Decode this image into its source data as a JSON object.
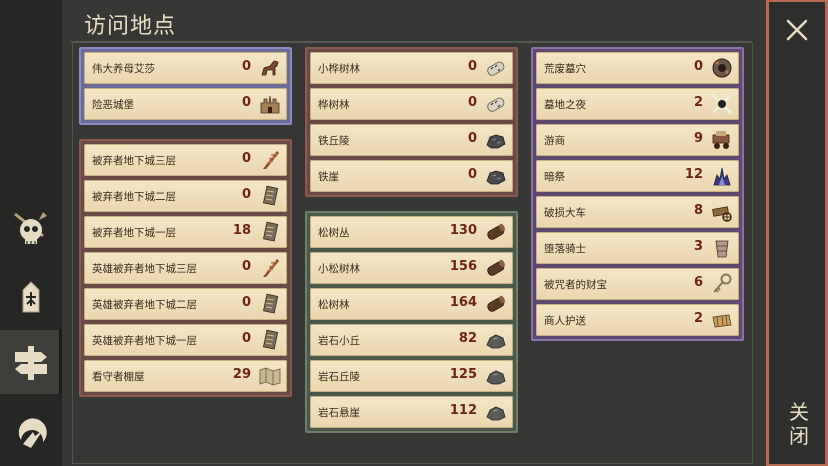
{
  "title": "访问地点",
  "close_label": "关闭",
  "sidebar": [
    {
      "icon": "skull-icon",
      "active": false
    },
    {
      "icon": "chess-piece-icon",
      "active": false
    },
    {
      "icon": "signpost-icon",
      "active": true
    },
    {
      "icon": "crescent-icon",
      "active": false
    }
  ],
  "groups": [
    {
      "frame": "blue",
      "items": [
        {
          "name": "伟大养母艾莎",
          "count": "0",
          "icon": "horse-icon"
        },
        {
          "name": "险恶城堡",
          "count": "0",
          "icon": "castle-icon"
        }
      ]
    },
    {
      "frame": "red",
      "items": [
        {
          "name": "被弃者地下城三层",
          "count": "0",
          "icon": "feather-quill-icon"
        },
        {
          "name": "被弃者地下城二层",
          "count": "0",
          "icon": "scroll-icon"
        },
        {
          "name": "被弃者地下城一层",
          "count": "18",
          "icon": "scroll-icon"
        },
        {
          "name": "英雄被弃者地下城三层",
          "count": "0",
          "icon": "feather-quill-icon"
        },
        {
          "name": "英雄被弃者地下城二层",
          "count": "0",
          "icon": "scroll-icon"
        },
        {
          "name": "英雄被弃者地下城一层",
          "count": "0",
          "icon": "scroll-icon"
        },
        {
          "name": "看守者棚屋",
          "count": "29",
          "icon": "map-icon"
        }
      ]
    },
    {
      "frame": "red",
      "items": [
        {
          "name": "小桦树林",
          "count": "0",
          "icon": "birch-log-icon"
        },
        {
          "name": "桦树林",
          "count": "0",
          "icon": "birch-log-icon"
        },
        {
          "name": "铁丘陵",
          "count": "0",
          "icon": "iron-ore-icon"
        },
        {
          "name": "铁崖",
          "count": "0",
          "icon": "iron-ore-icon"
        }
      ]
    },
    {
      "frame": "green",
      "items": [
        {
          "name": "松树丛",
          "count": "130",
          "icon": "pine-log-icon"
        },
        {
          "name": "小松树林",
          "count": "156",
          "icon": "pine-log-icon"
        },
        {
          "name": "松树林",
          "count": "164",
          "icon": "pine-log-icon"
        },
        {
          "name": "岩石小丘",
          "count": "82",
          "icon": "stone-icon"
        },
        {
          "name": "岩石丘陵",
          "count": "125",
          "icon": "stone-icon"
        },
        {
          "name": "岩石悬崖",
          "count": "112",
          "icon": "stone-icon"
        }
      ]
    },
    {
      "frame": "purple",
      "items": [
        {
          "name": "荒废墓穴",
          "count": "0",
          "icon": "crypt-icon"
        },
        {
          "name": "墓地之夜",
          "count": "2",
          "icon": "crossed-bones-icon"
        },
        {
          "name": "游商",
          "count": "9",
          "icon": "cart-icon"
        },
        {
          "name": "暗祭",
          "count": "12",
          "icon": "dark-flame-icon"
        },
        {
          "name": "破损大车",
          "count": "8",
          "icon": "broken-cart-icon"
        },
        {
          "name": "堕落骑士",
          "count": "3",
          "icon": "bucket-icon"
        },
        {
          "name": "被咒者的财宝",
          "count": "6",
          "icon": "key-icon"
        },
        {
          "name": "商人护送",
          "count": "2",
          "icon": "caravan-icon"
        }
      ]
    }
  ]
}
